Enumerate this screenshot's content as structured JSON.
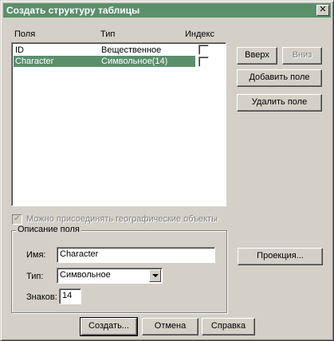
{
  "window": {
    "title": "Создать структуру таблицы",
    "close_glyph": "✕"
  },
  "fields_list": {
    "headers": {
      "name": "Поля",
      "type": "Тип",
      "index": "Индекс"
    },
    "rows": [
      {
        "name": "ID",
        "type": "Вещественное",
        "indexed": false,
        "selected": false
      },
      {
        "name": "Character",
        "type": "Символьное(14)",
        "indexed": false,
        "selected": true
      }
    ]
  },
  "buttons": {
    "up": "Вверх",
    "down": "Вниз",
    "add_field": "Добавить поле",
    "delete_field": "Удалить поле",
    "projection": "Проекция...",
    "create": "Создать...",
    "cancel": "Отмена",
    "help": "Справка"
  },
  "geo_checkbox": {
    "label": "Можно присоединять географические объекты",
    "checked": true,
    "enabled": false
  },
  "field_description": {
    "legend": "Описание поля",
    "name_label": "Имя:",
    "name_value": "Character",
    "type_label": "Тип:",
    "type_value": "Символьное",
    "width_label": "Знаков:",
    "width_value": "14"
  },
  "icons": {
    "close": "close-icon",
    "dropdown": "chevron-down-icon",
    "check": "check-icon"
  },
  "colors": {
    "titlebar": "#5a8f6c",
    "selection": "#5a8f6c",
    "face": "#d4d0c8"
  }
}
